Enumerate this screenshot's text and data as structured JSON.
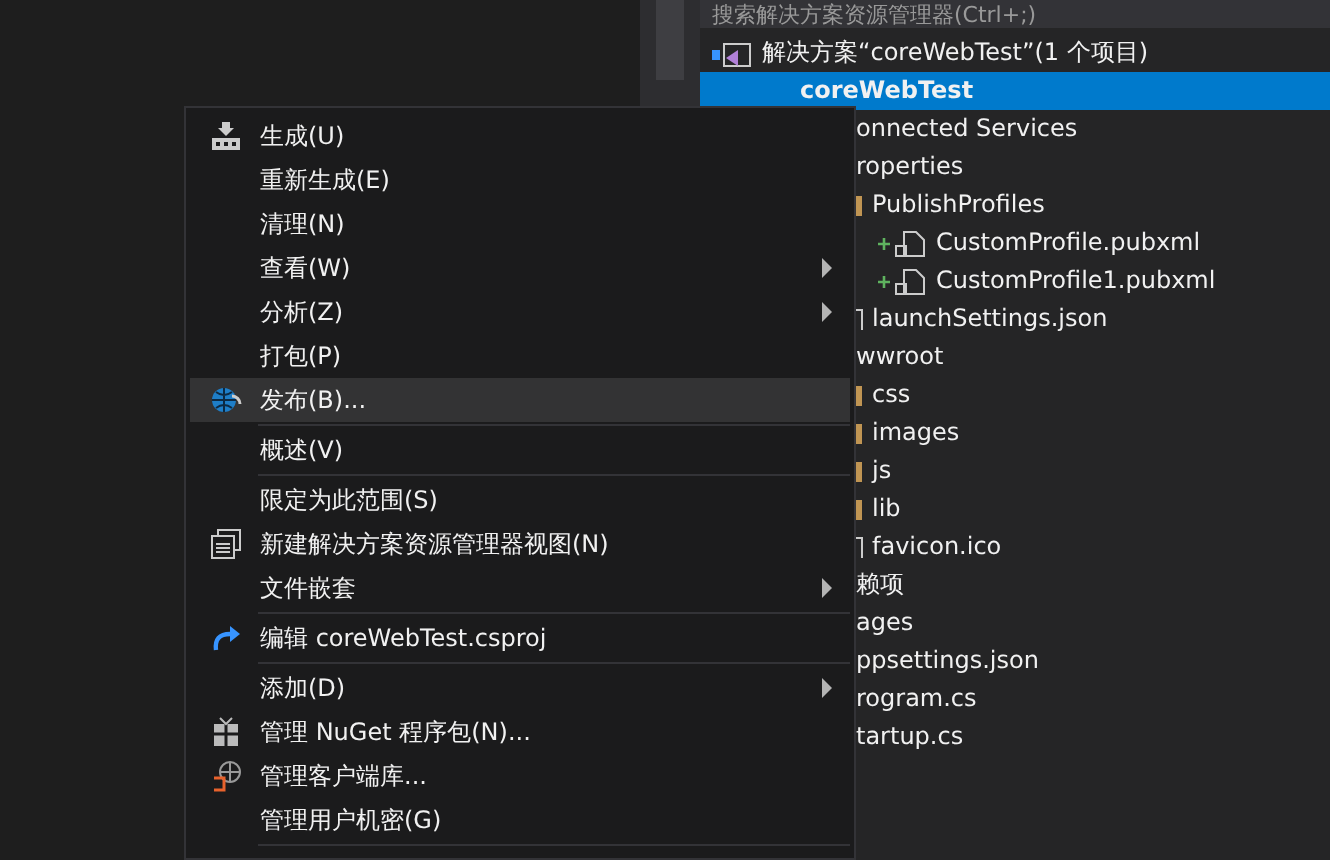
{
  "search": {
    "placeholder": "搜索解决方案资源管理器(Ctrl+;)"
  },
  "tree": [
    {
      "label": "解决方案“coreWebTest”(1 个项目)",
      "kind": "solution",
      "selected": false,
      "children": [
        {
          "label": "coreWebTest",
          "selected": true,
          "children": [
            {
              "label": "onnected Services",
              "selected": false
            },
            {
              "label": "roperties",
              "selected": false,
              "children": [
                {
                  "label": "PublishProfiles",
                  "kind": "folder",
                  "selected": false,
                  "children": [
                    {
                      "label": "CustomProfile.pubxml",
                      "kind": "added",
                      "selected": false
                    },
                    {
                      "label": "CustomProfile1.pubxml",
                      "kind": "added",
                      "selected": false
                    }
                  ]
                },
                {
                  "label": "launchSettings.json",
                  "kind": "file",
                  "selected": false
                }
              ]
            },
            {
              "label": "wwroot",
              "selected": false,
              "children": [
                {
                  "label": "css",
                  "kind": "folder",
                  "selected": false
                },
                {
                  "label": "images",
                  "kind": "folder",
                  "selected": false
                },
                {
                  "label": "js",
                  "kind": "folder",
                  "selected": false
                },
                {
                  "label": "lib",
                  "kind": "folder",
                  "selected": false
                },
                {
                  "label": "favicon.ico",
                  "kind": "file",
                  "selected": false
                }
              ]
            },
            {
              "label": "赖项",
              "selected": false
            },
            {
              "label": "ages",
              "selected": false
            },
            {
              "label": "ppsettings.json",
              "selected": false
            },
            {
              "label": "rogram.cs",
              "selected": false
            },
            {
              "label": "tartup.cs",
              "selected": false
            }
          ]
        }
      ]
    }
  ],
  "menu": [
    {
      "label": "生成(U)",
      "kind": "build",
      "submenu": false,
      "selected": false,
      "separator_after": false
    },
    {
      "label": "重新生成(E)",
      "submenu": false,
      "selected": false,
      "separator_after": false
    },
    {
      "label": "清理(N)",
      "submenu": false,
      "selected": false,
      "separator_after": false
    },
    {
      "label": "查看(W)",
      "submenu": true,
      "selected": false,
      "separator_after": false
    },
    {
      "label": "分析(Z)",
      "submenu": true,
      "selected": false,
      "separator_after": false
    },
    {
      "label": "打包(P)",
      "submenu": false,
      "selected": false,
      "separator_after": false
    },
    {
      "label": "发布(B)...",
      "kind": "publish",
      "submenu": false,
      "selected": true,
      "separator_after": true
    },
    {
      "label": "概述(V)",
      "submenu": false,
      "selected": false,
      "separator_after": true
    },
    {
      "label": "限定为此范围(S)",
      "submenu": false,
      "selected": false,
      "separator_after": false
    },
    {
      "label": "新建解决方案资源管理器视图(N)",
      "kind": "view",
      "submenu": false,
      "selected": false,
      "separator_after": false
    },
    {
      "label": "文件嵌套",
      "submenu": true,
      "selected": false,
      "separator_after": true
    },
    {
      "label": "编辑 coreWebTest.csproj",
      "kind": "edit",
      "submenu": false,
      "selected": false,
      "separator_after": true
    },
    {
      "label": "添加(D)",
      "submenu": true,
      "selected": false,
      "separator_after": false
    },
    {
      "label": "管理 NuGet 程序包(N)...",
      "kind": "nuget",
      "submenu": false,
      "selected": false,
      "separator_after": false
    },
    {
      "label": "管理客户端库...",
      "kind": "library",
      "submenu": false,
      "selected": false,
      "separator_after": false
    },
    {
      "label": "管理用户机密(G)",
      "submenu": false,
      "selected": false,
      "separator_after": true
    }
  ]
}
